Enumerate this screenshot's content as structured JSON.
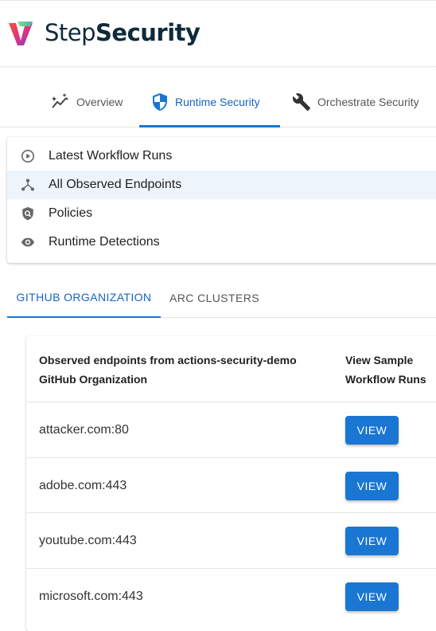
{
  "brand": {
    "name_part1": "Step",
    "name_part2": "Security"
  },
  "nav": {
    "items": [
      {
        "label": "Overview",
        "icon": "sparkline-icon"
      },
      {
        "label": "Runtime Security",
        "icon": "shield-icon",
        "active": true
      },
      {
        "label": "Orchestrate Security",
        "icon": "wrench-icon"
      }
    ]
  },
  "menu": {
    "items": [
      {
        "label": "Latest Workflow Runs",
        "icon": "play-circle-icon"
      },
      {
        "label": "All Observed Endpoints",
        "icon": "network-icon",
        "selected": true
      },
      {
        "label": "Policies",
        "icon": "policy-icon"
      },
      {
        "label": "Runtime Detections",
        "icon": "eye-icon"
      }
    ]
  },
  "tabs": [
    {
      "label": "GITHUB ORGANIZATION",
      "active": true
    },
    {
      "label": "ARC CLUSTERS"
    }
  ],
  "table": {
    "headers": {
      "endpoints": [
        "Observed endpoints from actions-security-demo",
        "GitHub Organization"
      ],
      "runs": [
        "View Sample",
        "Workflow Runs"
      ]
    },
    "rows": [
      {
        "endpoint": "attacker.com:80",
        "action": "VIEW"
      },
      {
        "endpoint": "adobe.com:443",
        "action": "VIEW"
      },
      {
        "endpoint": "youtube.com:443",
        "action": "VIEW"
      },
      {
        "endpoint": "microsoft.com:443",
        "action": "VIEW"
      }
    ]
  },
  "colors": {
    "accent": "#1976d2",
    "selected_bg": "#eef4fc",
    "brand_text": "#0f2a3a"
  }
}
